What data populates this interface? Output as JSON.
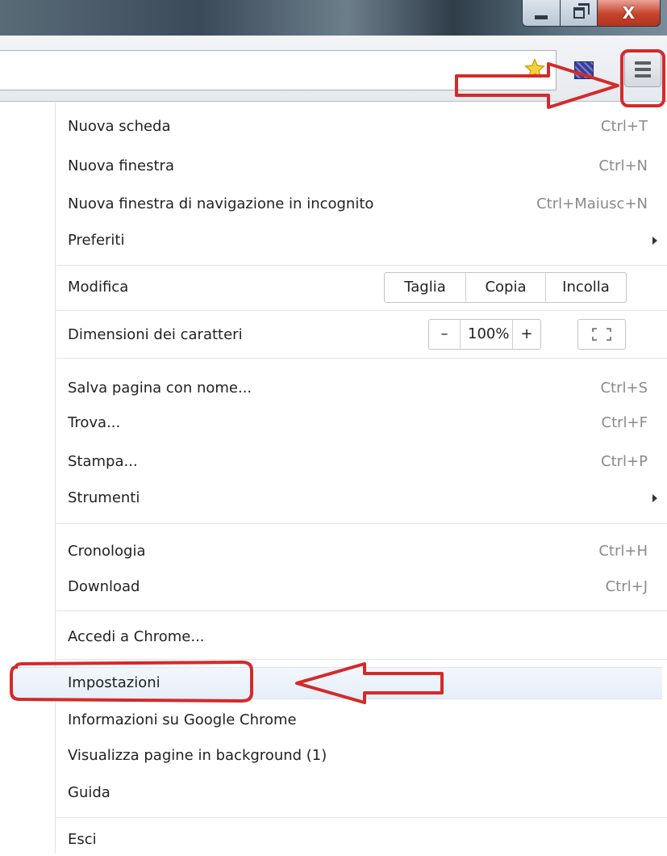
{
  "window": {
    "minimize_icon": "minimize-icon",
    "maximize_icon": "restore-icon",
    "close_label": "X"
  },
  "toolbar": {
    "star_icon": "bookmark-star-icon",
    "extension_icon": "extension-icon",
    "menu_icon": "hamburger-menu-icon"
  },
  "menu": {
    "new_tab": {
      "label": "Nuova scheda",
      "shortcut": "Ctrl+T"
    },
    "new_window": {
      "label": "Nuova finestra",
      "shortcut": "Ctrl+N"
    },
    "incognito": {
      "label": "Nuova finestra di navigazione in incognito",
      "shortcut": "Ctrl+Maiusc+N"
    },
    "bookmarks": {
      "label": "Preferiti"
    },
    "edit": {
      "label": "Modifica",
      "cut": "Taglia",
      "copy": "Copia",
      "paste": "Incolla"
    },
    "zoom": {
      "label": "Dimensioni dei caratteri",
      "minus": "–",
      "value": "100%",
      "plus": "+"
    },
    "save_page": {
      "label": "Salva pagina con nome...",
      "shortcut": "Ctrl+S"
    },
    "find": {
      "label": "Trova...",
      "shortcut": "Ctrl+F"
    },
    "print": {
      "label": "Stampa...",
      "shortcut": "Ctrl+P"
    },
    "tools": {
      "label": "Strumenti"
    },
    "history": {
      "label": "Cronologia",
      "shortcut": "Ctrl+H"
    },
    "downloads": {
      "label": "Download",
      "shortcut": "Ctrl+J"
    },
    "sign_in": {
      "label": "Accedi a Chrome..."
    },
    "settings": {
      "label": "Impostazioni"
    },
    "about": {
      "label": "Informazioni su Google Chrome"
    },
    "background_pages": {
      "label": "Visualizza pagine in background (1)"
    },
    "help": {
      "label": "Guida"
    },
    "exit": {
      "label": "Esci"
    }
  },
  "annotations": {
    "color": "#d42a2a"
  }
}
